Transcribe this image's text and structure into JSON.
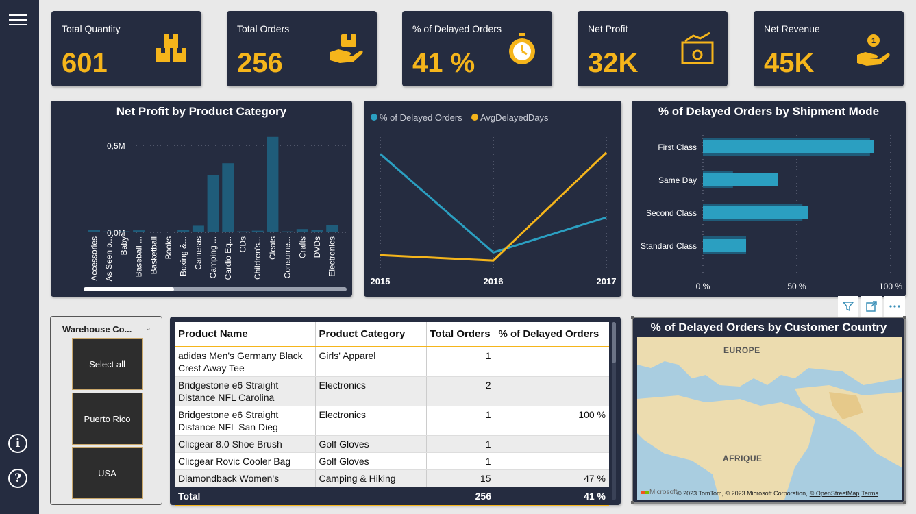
{
  "kpis": [
    {
      "title": "Total Quantity",
      "value": "601",
      "icon": "boxes-icon"
    },
    {
      "title": "Total Orders",
      "value": "256",
      "icon": "hand-box-icon"
    },
    {
      "title": "% of Delayed Orders",
      "value": "41 %",
      "icon": "stopwatch-icon"
    },
    {
      "title": "Net Profit",
      "value": "32K",
      "icon": "profit-chart-icon"
    },
    {
      "title": "Net Revenue",
      "value": "45K",
      "icon": "hand-coin-icon"
    }
  ],
  "colors": {
    "accent": "#f5b51b",
    "panel": "#252c40",
    "teal": "#2b9fc1",
    "bar": "#1f5c7a"
  },
  "chart_data": [
    {
      "type": "bar",
      "title": "Net Profit by Product Category",
      "y_ticks": [
        "0,5M",
        "0,0M"
      ],
      "ylim": [
        0,
        0.6
      ],
      "categories": [
        "Accessories",
        "As Seen o...",
        "Baby",
        "Baseball ...",
        "Basketball",
        "Books",
        "Boxing &...",
        "Cameras",
        "Camping ...",
        "Cardio Eq...",
        "CDs",
        "Children's...",
        "Cleats",
        "Consume...",
        "Crafts",
        "DVDs",
        "Electronics"
      ],
      "values": [
        0.015,
        0.005,
        0.006,
        0.012,
        0.004,
        0.003,
        0.013,
        0.04,
        0.35,
        0.42,
        0.006,
        0.01,
        0.58,
        0.006,
        0.02,
        0.016,
        0.045
      ]
    },
    {
      "type": "line",
      "x": [
        "2015",
        "2016",
        "2017"
      ],
      "series": [
        {
          "name": "% of Delayed Orders",
          "values": [
            0.85,
            0.12,
            0.38
          ],
          "color": "#2b9fc1"
        },
        {
          "name": "AvgDelayedDays",
          "values": [
            0.1,
            0.06,
            0.86
          ],
          "color": "#f5b51b"
        }
      ]
    },
    {
      "type": "bar",
      "orientation": "horizontal",
      "title": "% of Delayed Orders by Shipment Mode",
      "categories": [
        "First Class",
        "Same Day",
        "Second Class",
        "Standard Class"
      ],
      "values": [
        91,
        40,
        56,
        23
      ],
      "background_values": [
        89,
        16,
        53,
        23
      ],
      "x_ticks": [
        "0 %",
        "50 %",
        "100 %"
      ],
      "xlim": [
        0,
        100
      ]
    }
  ],
  "slicer": {
    "title": "Warehouse Co...",
    "options": [
      "Select all",
      "Puerto Rico",
      "USA"
    ]
  },
  "table": {
    "headers": [
      "Product Name",
      "Product Category",
      "Total Orders",
      "% of Delayed Orders"
    ],
    "rows": [
      [
        "adidas Men's Germany Black Crest Away Tee",
        "Girls' Apparel",
        "1",
        ""
      ],
      [
        "Bridgestone e6 Straight Distance NFL Carolina",
        "Electronics",
        "2",
        ""
      ],
      [
        "Bridgestone e6 Straight Distance NFL San Dieg",
        "Electronics",
        "1",
        "100 %"
      ],
      [
        "Clicgear 8.0 Shoe Brush",
        "Golf Gloves",
        "1",
        ""
      ],
      [
        "Clicgear Rovic Cooler Bag",
        "Golf Gloves",
        "1",
        ""
      ],
      [
        "Diamondback Women's",
        "Camping & Hiking",
        "15",
        "47 %"
      ]
    ],
    "total": [
      "Total",
      "",
      "256",
      "41 %"
    ]
  },
  "map": {
    "title": "% of Delayed Orders by Customer Country",
    "labels": [
      "EUROPE",
      "AFRIQUE"
    ],
    "brand": "Microsoft",
    "credits": "© 2023 TomTom, © 2023 Microsoft Corporation,",
    "osm": "© OpenStreetMap",
    "terms": "Terms"
  }
}
